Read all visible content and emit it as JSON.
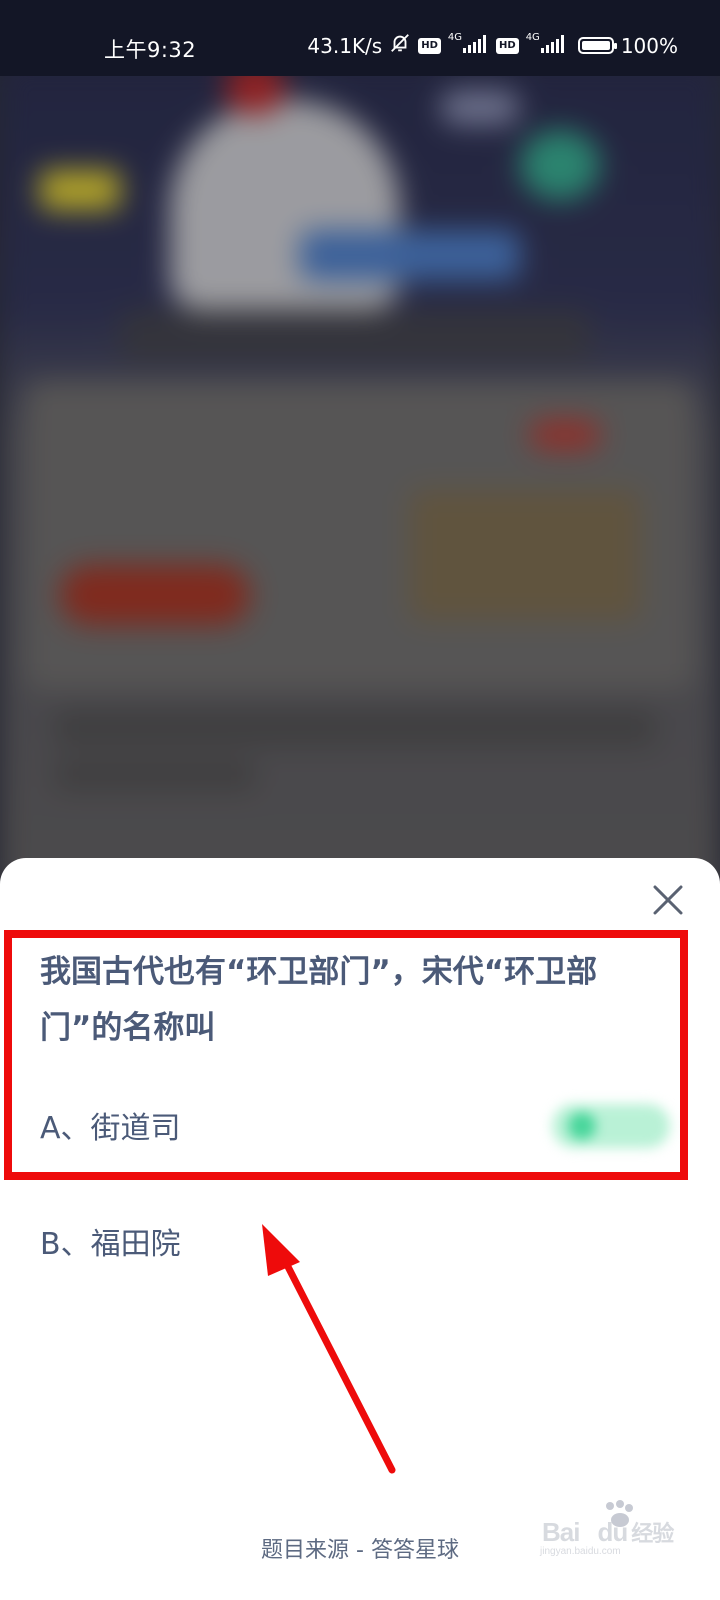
{
  "status_bar": {
    "time": "上午9:32",
    "net_speed": "43.1K/s",
    "hd_label": "HD",
    "network_type": "4G",
    "battery": "100%"
  },
  "quiz": {
    "question": "我国古代也有“环卫部门”，宋代“环卫部门”的名称叫",
    "options": [
      {
        "label": "A、街道司"
      },
      {
        "label": "B、福田院"
      }
    ],
    "source": "题目来源 - 答答星球"
  },
  "watermark": {
    "brand": "Bai",
    "brand2": "du",
    "suffix": "经验",
    "url": "jingyan.baidu.com"
  },
  "colors": {
    "annotation": "#ee0b0b",
    "text": "#4b5a78"
  },
  "icons": [
    "bell-off-icon",
    "signal-icon",
    "battery-icon",
    "close-icon",
    "arrow-annotation"
  ]
}
